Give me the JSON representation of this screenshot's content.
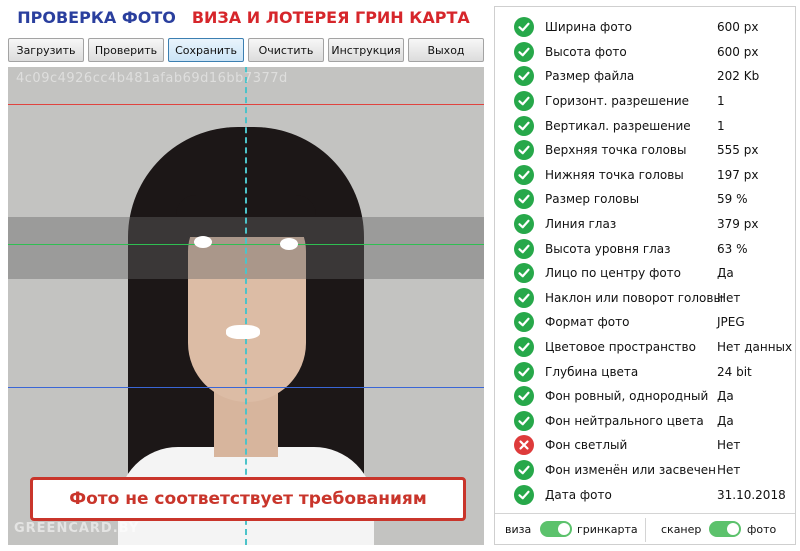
{
  "header": {
    "title_left": "ПРОВЕРКА ФОТО",
    "title_right": "ВИЗА И ЛОТЕРЕЯ ГРИН КАРТА"
  },
  "toolbar": {
    "load": "Загрузить",
    "check": "Проверить",
    "save": "Сохранить",
    "clear": "Очистить",
    "instructions": "Инструкция",
    "exit": "Выход"
  },
  "photo": {
    "hash": "4c09c4926cc4b481afab69d16bb7377d",
    "watermark": "GREENCARD.BY",
    "status_message": "Фото не соответствует требованиям"
  },
  "colors": {
    "ok": "#27a84a",
    "fail": "#de3b3b",
    "title_blue": "#2a3f9e",
    "title_red": "#d6262b",
    "guide_red": "#e0433f",
    "guide_green": "#2fbf52",
    "guide_blue": "#3a66d6",
    "guide_cyan": "#4cc3c9"
  },
  "checks": [
    {
      "label": "Ширина фото",
      "value": "600 px",
      "status": "ok"
    },
    {
      "label": "Высота фото",
      "value": "600 px",
      "status": "ok"
    },
    {
      "label": "Размер файла",
      "value": "202 Kb",
      "status": "ok"
    },
    {
      "label": "Горизонт. разрешение",
      "value": "1",
      "status": "ok"
    },
    {
      "label": "Вертикал. разрешение",
      "value": "1",
      "status": "ok"
    },
    {
      "label": "Верхняя точка головы",
      "value": "555 px",
      "status": "ok"
    },
    {
      "label": "Нижняя точка головы",
      "value": "197 px",
      "status": "ok"
    },
    {
      "label": "Размер головы",
      "value": "59 %",
      "status": "ok"
    },
    {
      "label": "Линия глаз",
      "value": "379 px",
      "status": "ok"
    },
    {
      "label": "Высота уровня глаз",
      "value": "63 %",
      "status": "ok"
    },
    {
      "label": "Лицо по центру фото",
      "value": "Да",
      "status": "ok"
    },
    {
      "label": "Наклон или поворот головы",
      "value": "Нет",
      "status": "ok"
    },
    {
      "label": "Формат фото",
      "value": "JPEG",
      "status": "ok"
    },
    {
      "label": "Цветовое пространство",
      "value": "Нет данных",
      "status": "ok"
    },
    {
      "label": "Глубина цвета",
      "value": "24 bit",
      "status": "ok"
    },
    {
      "label": "Фон ровный, однородный",
      "value": "Да",
      "status": "ok"
    },
    {
      "label": "Фон нейтрального цвета",
      "value": "Да",
      "status": "ok"
    },
    {
      "label": "Фон светлый",
      "value": "Нет",
      "status": "fail"
    },
    {
      "label": "Фон изменён или засвечен",
      "value": "Нет",
      "status": "ok"
    },
    {
      "label": "Дата фото",
      "value": "31.10.2018",
      "status": "ok"
    }
  ],
  "toggles": {
    "mode_left": "виза",
    "mode_right": "гринкарта",
    "mode_on": true,
    "source_left": "сканер",
    "source_right": "фото",
    "source_on": true
  }
}
